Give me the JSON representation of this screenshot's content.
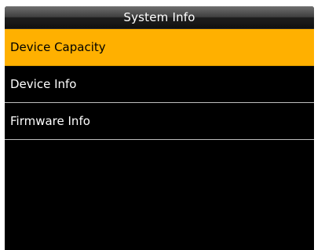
{
  "screen": {
    "title": "System Info"
  },
  "menu": {
    "items": [
      {
        "label": "Device Capacity",
        "selected": true
      },
      {
        "label": "Device Info",
        "selected": false
      },
      {
        "label": "Firmware Info",
        "selected": false
      }
    ]
  },
  "colors": {
    "selection": "#ffb000",
    "background": "#000000",
    "text": "#ffffff"
  }
}
